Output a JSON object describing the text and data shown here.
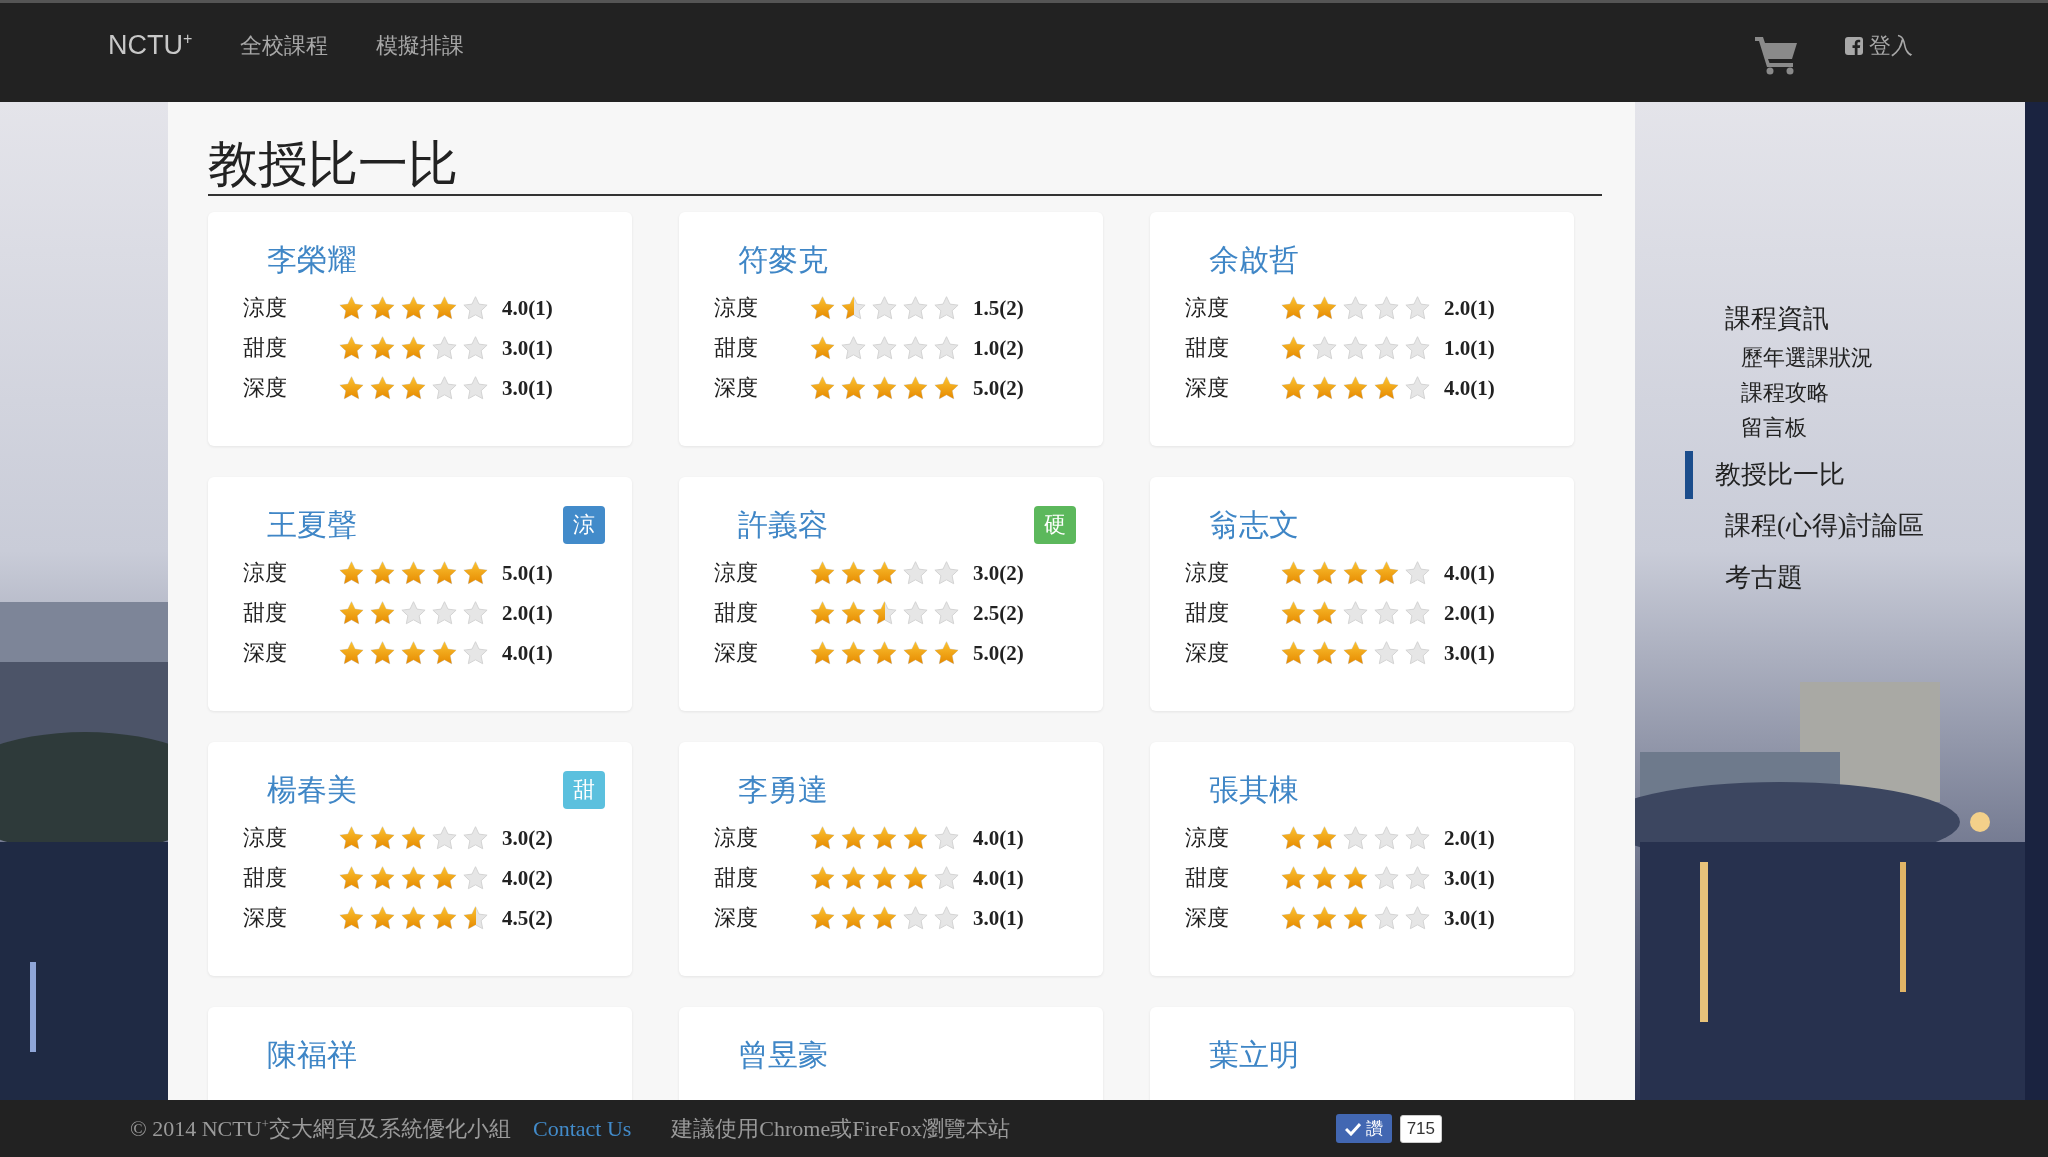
{
  "navbar": {
    "brand": "NCTU$^{+}$",
    "links": [
      {
        "label": "全校課程"
      },
      {
        "label": "模擬排課"
      }
    ],
    "login": "登入"
  },
  "page": {
    "title": "教授比一比"
  },
  "cards": [
    {
      "name": "李榮耀",
      "ratings": [
        {
          "label": "涼度",
          "stars": 4,
          "reading": "4.0(1)"
        },
        {
          "label": "甜度",
          "stars": 3,
          "reading": "3.0(1)"
        },
        {
          "label": "深度",
          "stars": 3,
          "reading": "3.0(1)"
        }
      ]
    },
    {
      "name": "符麥克",
      "ratings": [
        {
          "label": "涼度",
          "stars": 1.5,
          "reading": "1.5(2)"
        },
        {
          "label": "甜度",
          "stars": 1,
          "reading": "1.0(2)"
        },
        {
          "label": "深度",
          "stars": 5,
          "reading": "5.0(2)"
        }
      ]
    },
    {
      "name": "余啟哲",
      "ratings": [
        {
          "label": "涼度",
          "stars": 2,
          "reading": "2.0(1)"
        },
        {
          "label": "甜度",
          "stars": 1,
          "reading": "1.0(1)"
        },
        {
          "label": "深度",
          "stars": 4,
          "reading": "4.0(1)"
        }
      ]
    },
    {
      "name": "王夏聲",
      "tag": {
        "label": "涼",
        "color": "#428bca"
      },
      "ratings": [
        {
          "label": "涼度",
          "stars": 5,
          "reading": "5.0(1)"
        },
        {
          "label": "甜度",
          "stars": 2,
          "reading": "2.0(1)"
        },
        {
          "label": "深度",
          "stars": 4,
          "reading": "4.0(1)"
        }
      ]
    },
    {
      "name": "許義容",
      "tag": {
        "label": "硬",
        "color": "#5cb85c"
      },
      "ratings": [
        {
          "label": "涼度",
          "stars": 3,
          "reading": "3.0(2)"
        },
        {
          "label": "甜度",
          "stars": 2.5,
          "reading": "2.5(2)"
        },
        {
          "label": "深度",
          "stars": 5,
          "reading": "5.0(2)"
        }
      ]
    },
    {
      "name": "翁志文",
      "ratings": [
        {
          "label": "涼度",
          "stars": 4,
          "reading": "4.0(1)"
        },
        {
          "label": "甜度",
          "stars": 2,
          "reading": "2.0(1)"
        },
        {
          "label": "深度",
          "stars": 3,
          "reading": "3.0(1)"
        }
      ]
    },
    {
      "name": "楊春美",
      "tag": {
        "label": "甜",
        "color": "#5bc0de"
      },
      "ratings": [
        {
          "label": "涼度",
          "stars": 3,
          "reading": "3.0(2)"
        },
        {
          "label": "甜度",
          "stars": 4,
          "reading": "4.0(2)"
        },
        {
          "label": "深度",
          "stars": 4.5,
          "reading": "4.5(2)"
        }
      ]
    },
    {
      "name": "李勇達",
      "ratings": [
        {
          "label": "涼度",
          "stars": 4,
          "reading": "4.0(1)"
        },
        {
          "label": "甜度",
          "stars": 4,
          "reading": "4.0(1)"
        },
        {
          "label": "深度",
          "stars": 3,
          "reading": "3.0(1)"
        }
      ]
    },
    {
      "name": "張其棟",
      "ratings": [
        {
          "label": "涼度",
          "stars": 2,
          "reading": "2.0(1)"
        },
        {
          "label": "甜度",
          "stars": 3,
          "reading": "3.0(1)"
        },
        {
          "label": "深度",
          "stars": 3,
          "reading": "3.0(1)"
        }
      ]
    },
    {
      "name": "陳福祥"
    },
    {
      "name": "曾昱豪"
    },
    {
      "name": "葉立明"
    }
  ],
  "sidebar": {
    "items": [
      {
        "label": "課程資訊",
        "selected": false,
        "children": [
          {
            "label": "歷年選課狀況",
            "selected": false
          },
          {
            "label": "課程攻略",
            "selected": false
          },
          {
            "label": "留言板",
            "selected": false
          }
        ]
      },
      {
        "label": "教授比一比",
        "selected": true
      },
      {
        "label": "課程(心得)討論區",
        "selected": false
      },
      {
        "label": "考古題",
        "selected": false
      }
    ]
  },
  "footer": {
    "copyright": "© 2014 NCTU$^{+}$交大網頁及系統優化小組",
    "contact": "Contact Us",
    "note": "建議使用Chrome或FireFox瀏覽本站",
    "like": {
      "label": "讚",
      "count": "715"
    }
  }
}
